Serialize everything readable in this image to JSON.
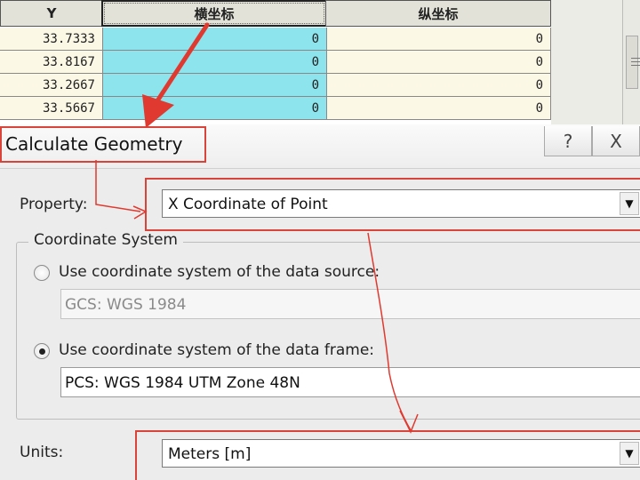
{
  "table": {
    "columns": [
      {
        "label": "Y"
      },
      {
        "label": "横坐标"
      },
      {
        "label": "纵坐标"
      }
    ],
    "rows": [
      {
        "y": "33.7333",
        "x_coord": "0",
        "y_coord": "0"
      },
      {
        "y": "33.8167",
        "x_coord": "0",
        "y_coord": "0"
      },
      {
        "y": "33.2667",
        "x_coord": "0",
        "y_coord": "0"
      },
      {
        "y": "33.5667",
        "x_coord": "0",
        "y_coord": "0"
      }
    ]
  },
  "dialog": {
    "title": "Calculate Geometry",
    "help_icon": "?",
    "close_icon": "X",
    "property_label": "Property:",
    "property_value": "X Coordinate of Point",
    "coord_group_label": "Coordinate System",
    "option_source_label": "Use coordinate system of the data source:",
    "option_source_value": "GCS: WGS 1984",
    "option_frame_label": "Use coordinate system of the data frame:",
    "option_frame_value": "PCS: WGS 1984 UTM Zone 48N",
    "units_label": "Units:",
    "units_value": "Meters [m]",
    "dropdown_arrow": "▼",
    "selected_option": "data_frame"
  },
  "colors": {
    "annotation": "#d9443a",
    "selected_column": "#8de4ec",
    "row_background": "#fbf8e6"
  }
}
